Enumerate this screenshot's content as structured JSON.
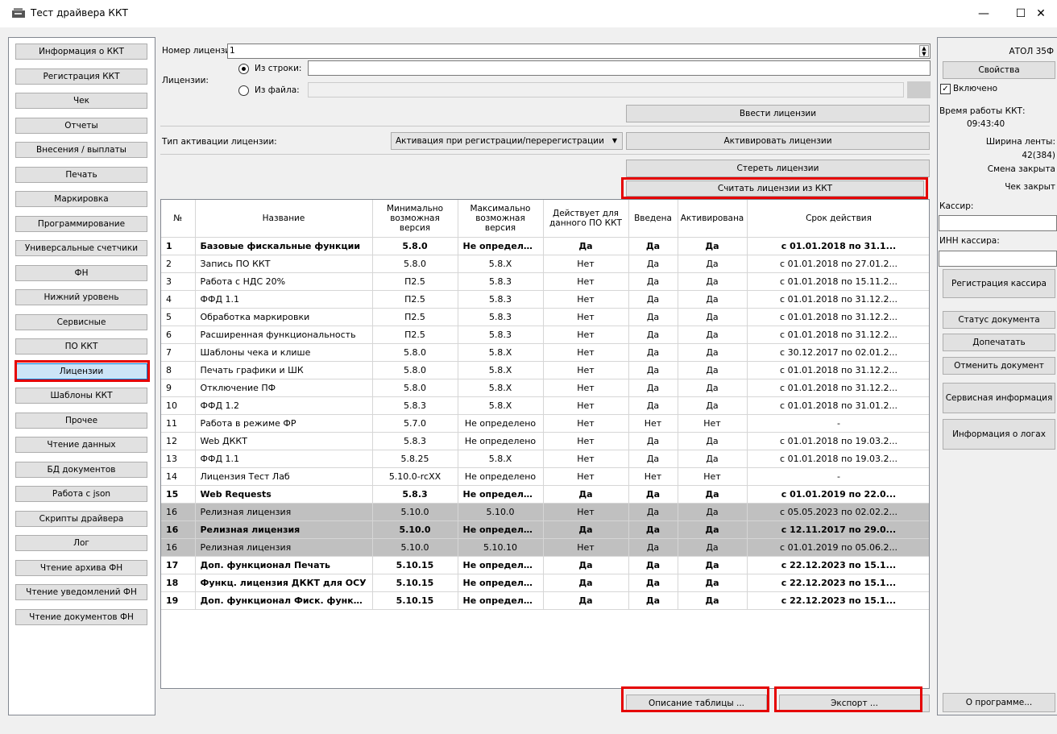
{
  "window": {
    "title": "Тест драйвера ККТ",
    "minimize": "—",
    "maximize": "☐",
    "close": "✕"
  },
  "sidebar": {
    "items": [
      {
        "label": "Информация о ККТ"
      },
      {
        "label": "Регистрация ККТ"
      },
      {
        "label": "Чек"
      },
      {
        "label": "Отчеты"
      },
      {
        "label": "Внесения / выплаты"
      },
      {
        "label": "Печать"
      },
      {
        "label": "Маркировка"
      },
      {
        "label": "Программирование"
      },
      {
        "label": "Универсальные счетчики"
      },
      {
        "label": "ФН"
      },
      {
        "label": "Нижний уровень"
      },
      {
        "label": "Сервисные"
      },
      {
        "label": "ПО ККТ"
      },
      {
        "label": "Лицензии"
      },
      {
        "label": "Шаблоны ККТ"
      },
      {
        "label": "Прочее"
      },
      {
        "label": "Чтение данных"
      },
      {
        "label": "БД документов"
      },
      {
        "label": "Работа с json"
      },
      {
        "label": "Скрипты драйвера"
      },
      {
        "label": "Лог"
      },
      {
        "label": "Чтение архива ФН"
      },
      {
        "label": "Чтение уведомлений ФН"
      },
      {
        "label": "Чтение документов ФН"
      }
    ],
    "active_index": 13
  },
  "form": {
    "license_number_label": "Номер лицензии:",
    "license_number_value": "1",
    "licenses_label": "Лицензии:",
    "from_string_label": "Из строки:",
    "from_string_value": "",
    "from_file_label": "Из файла:",
    "from_file_value": "",
    "enter_licenses_button": "Ввести лицензии",
    "activation_type_label": "Тип активации лицензии:",
    "activation_type_value": "Активация при регистрации/перерегистрации",
    "activate_button": "Активировать лицензии",
    "erase_button": "Стереть лицензии",
    "read_button": "Считать лицензии из ККТ"
  },
  "table": {
    "columns": [
      "№",
      "Название",
      "Минимально возможная версия",
      "Максимально возможная версия",
      "Действует для данного ПО ККТ",
      "Введена",
      "Активирована",
      "Срок действия"
    ],
    "rows": [
      {
        "style": "b",
        "cells": [
          "1",
          "Базовые фискальные функции",
          "5.8.0",
          "Не определено",
          "Да",
          "Да",
          "Да",
          "с 01.01.2018 по 31.1..."
        ]
      },
      {
        "style": "",
        "cells": [
          "2",
          "Запись ПО ККТ",
          "5.8.0",
          "5.8.X",
          "Нет",
          "Да",
          "Да",
          "с 01.01.2018 по 27.01.2..."
        ]
      },
      {
        "style": "",
        "cells": [
          "3",
          "Работа с НДС 20%",
          "П2.5",
          "5.8.3",
          "Нет",
          "Да",
          "Да",
          "с 01.01.2018 по 15.11.2..."
        ]
      },
      {
        "style": "",
        "cells": [
          "4",
          "ФФД 1.1",
          "П2.5",
          "5.8.3",
          "Нет",
          "Да",
          "Да",
          "с 01.01.2018 по 31.12.2..."
        ]
      },
      {
        "style": "",
        "cells": [
          "5",
          "Обработка маркировки",
          "П2.5",
          "5.8.3",
          "Нет",
          "Да",
          "Да",
          "с 01.01.2018 по 31.12.2..."
        ]
      },
      {
        "style": "",
        "cells": [
          "6",
          "Расширенная функциональность",
          "П2.5",
          "5.8.3",
          "Нет",
          "Да",
          "Да",
          "с 01.01.2018 по 31.12.2..."
        ]
      },
      {
        "style": "",
        "cells": [
          "7",
          "Шаблоны чека и клише",
          "5.8.0",
          "5.8.X",
          "Нет",
          "Да",
          "Да",
          "с 30.12.2017 по 02.01.2..."
        ]
      },
      {
        "style": "",
        "cells": [
          "8",
          "Печать графики и ШК",
          "5.8.0",
          "5.8.X",
          "Нет",
          "Да",
          "Да",
          "с 01.01.2018 по 31.12.2..."
        ]
      },
      {
        "style": "",
        "cells": [
          "9",
          "Отключение ПФ",
          "5.8.0",
          "5.8.X",
          "Нет",
          "Да",
          "Да",
          "с 01.01.2018 по 31.12.2..."
        ]
      },
      {
        "style": "",
        "cells": [
          "10",
          "ФФД 1.2",
          "5.8.3",
          "5.8.X",
          "Нет",
          "Да",
          "Да",
          "с 01.01.2018 по 31.01.2..."
        ]
      },
      {
        "style": "",
        "cells": [
          "11",
          "Работа в режиме ФР",
          "5.7.0",
          "Не определено",
          "Нет",
          "Нет",
          "Нет",
          "-"
        ]
      },
      {
        "style": "",
        "cells": [
          "12",
          "Web ДККТ",
          "5.8.3",
          "Не определено",
          "Нет",
          "Да",
          "Да",
          "с 01.01.2018 по 19.03.2..."
        ]
      },
      {
        "style": "",
        "cells": [
          "13",
          "ФФД 1.1",
          "5.8.25",
          "5.8.X",
          "Нет",
          "Да",
          "Да",
          "с 01.01.2018 по 19.03.2..."
        ]
      },
      {
        "style": "",
        "cells": [
          "14",
          "Лицензия Тест Лаб",
          "5.10.0-rcXX",
          "Не определено",
          "Нет",
          "Нет",
          "Нет",
          "-"
        ]
      },
      {
        "style": "b",
        "cells": [
          "15",
          "Web Requests",
          "5.8.3",
          "Не определено",
          "Да",
          "Да",
          "Да",
          "с 01.01.2019 по 22.0..."
        ]
      },
      {
        "style": "g",
        "cells": [
          "16",
          "Релизная лицензия",
          "5.10.0",
          "5.10.0",
          "Нет",
          "Да",
          "Да",
          "с 05.05.2023 по 02.02.2..."
        ]
      },
      {
        "style": "g b",
        "cells": [
          "16",
          "Релизная лицензия",
          "5.10.0",
          "Не определено",
          "Да",
          "Да",
          "Да",
          "с 12.11.2017 по 29.0..."
        ]
      },
      {
        "style": "g",
        "cells": [
          "16",
          "Релизная лицензия",
          "5.10.0",
          "5.10.10",
          "Нет",
          "Да",
          "Да",
          "с 01.01.2019 по 05.06.2..."
        ]
      },
      {
        "style": "b",
        "cells": [
          "17",
          "Доп. функционал Печать",
          "5.10.15",
          "Не определено",
          "Да",
          "Да",
          "Да",
          "с 22.12.2023 по 15.1..."
        ]
      },
      {
        "style": "b",
        "cells": [
          "18",
          "Функц. лицензия ДККТ для ОСУ",
          "5.10.15",
          "Не определено",
          "Да",
          "Да",
          "Да",
          "с 22.12.2023 по 15.1..."
        ]
      },
      {
        "style": "b",
        "cells": [
          "19",
          "Доп. функционал Фиск. функции",
          "5.10.15",
          "Не определено",
          "Да",
          "Да",
          "Да",
          "с 22.12.2023 по 15.1..."
        ]
      }
    ]
  },
  "bottom": {
    "describe_button": "Описание таблицы ...",
    "export_button": "Экспорт ..."
  },
  "right_panel": {
    "model": "АТОЛ 35Ф",
    "properties_button": "Свойства",
    "enabled_label": "Включено",
    "enabled_checked": "✓",
    "uptime_label": "Время работы ККТ:",
    "uptime_value": "09:43:40",
    "tape_width_label": "Ширина ленты:",
    "tape_width_value": "42(384)",
    "shift_status": "Смена закрыта",
    "receipt_status": "Чек закрыт",
    "cashier_label": "Кассир:",
    "cashier_value": "",
    "inn_label": "ИНН кассира:",
    "inn_value": "",
    "register_cashier_button": "Регистрация кассира",
    "doc_status_button": "Статус документа",
    "reprint_button": "Допечатать",
    "cancel_doc_button": "Отменить документ",
    "service_info_button": "Сервисная информация",
    "log_info_button": "Информация о логах",
    "about_button": "О программе..."
  },
  "colors": {
    "highlight": "#e50000",
    "active_item": "#cce4f7",
    "grey_row": "#c0c0c0"
  }
}
